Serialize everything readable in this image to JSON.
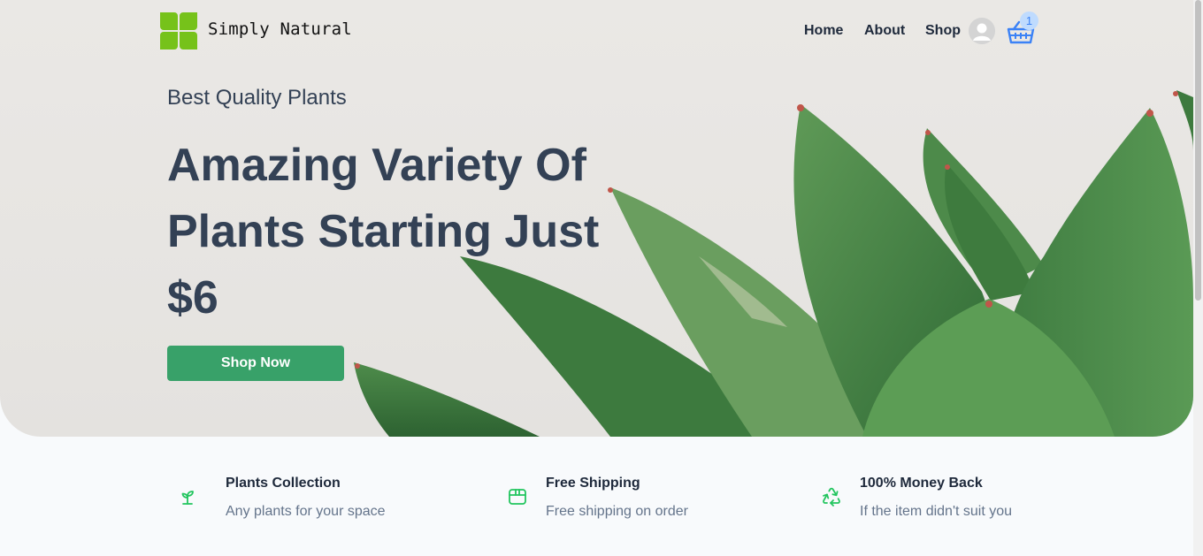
{
  "header": {
    "brand": "Simply Natural",
    "nav": {
      "home": "Home",
      "about": "About",
      "shop": "Shop"
    },
    "cart_count": "1"
  },
  "hero": {
    "tagline": "Best Quality Plants",
    "headline_line1": "Amazing Variety Of",
    "headline_line2": "Plants Starting Just",
    "headline_line3": "$6",
    "cta_label": "Shop Now"
  },
  "features": [
    {
      "icon": "sprout-icon",
      "title": "Plants Collection",
      "description": "Any plants for your space"
    },
    {
      "icon": "box-icon",
      "title": "Free Shipping",
      "description": "Free shipping on order"
    },
    {
      "icon": "recycle-icon",
      "title": "100% Money Back",
      "description": "If the item didn't suit you"
    }
  ],
  "colors": {
    "accent_green": "#38a169",
    "feature_icon_green": "#22c55e",
    "cart_blue": "#3b82f6",
    "logo_green": "#76c21a",
    "heading_slate": "#334155"
  }
}
